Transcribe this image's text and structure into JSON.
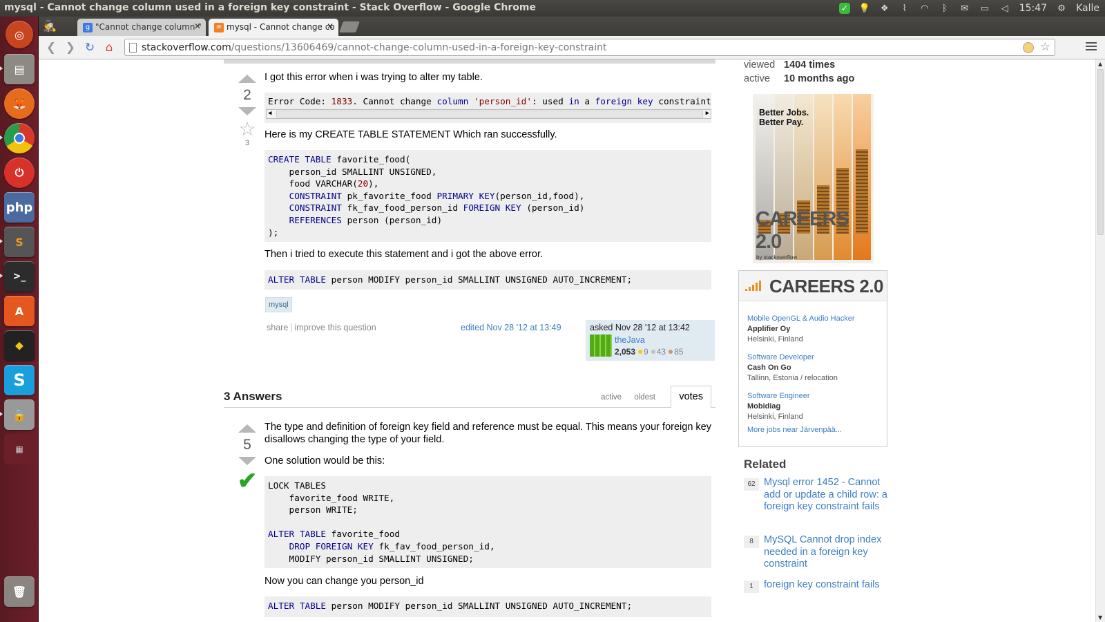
{
  "window": {
    "title": "mysql - Cannot change column used in a foreign key constraint - Stack Overflow - Google Chrome"
  },
  "tray": {
    "time": "15:47",
    "user": "Kalle"
  },
  "tabs": [
    {
      "label": "\"Cannot change column \"",
      "favicon": "google-icon"
    },
    {
      "label": "mysql - Cannot change co",
      "favicon": "stackoverflow-icon"
    }
  ],
  "address": {
    "host": "stackoverflow.com",
    "path": "/questions/13606469/cannot-change-column-used-in-a-foreign-key-constraint"
  },
  "question": {
    "votes": "2",
    "favorites": "3",
    "intro": "I got this error when i was trying to alter my table.",
    "create_intro": "Here is my CREATE TABLE STATEMENT Which ran successfully.",
    "then_text": "Then i tried to execute this statement and i got the above error.",
    "tag": "mysql",
    "share": "share",
    "improve": "improve this question",
    "edited": "edited Nov 28 '12 at 13:49",
    "asked": "asked Nov 28 '12 at 13:42",
    "user": "theJava",
    "rep": "2,053",
    "gold": "9",
    "silver": "43",
    "bronze": "85"
  },
  "answers": {
    "count_label": "3 Answers",
    "tabs": [
      "active",
      "oldest",
      "votes"
    ],
    "top": {
      "votes": "5",
      "text1": "The type and definition of foreign key field and reference must be equal. This means your foreign key",
      "text2": "disallows changing the type of your field.",
      "solution": "One solution would be this:",
      "now": "Now you can change you person_id"
    }
  },
  "sidebar": {
    "viewed_label": "viewed",
    "viewed_value": "1404 times",
    "active_label": "active",
    "active_value": "10 months ago",
    "ad_tagline1": "Better Jobs.",
    "ad_tagline2": "Better Pay.",
    "ad_brand": "CAREERS 2.0",
    "ad_by": "by stackoverflow",
    "careers_title": "CAREERS 2.0",
    "jobs": [
      {
        "title": "Mobile OpenGL & Audio Hacker",
        "company": "Applifier Oy",
        "location": "Helsinki, Finland"
      },
      {
        "title": "Software Developer",
        "company": "Cash On Go",
        "location": "Tallinn, Estonia / relocation"
      },
      {
        "title": "Software Engineer",
        "company": "Mobidiag",
        "location": "Helsinki, Finland"
      }
    ],
    "more_jobs": "More jobs near Järvenpää...",
    "related_title": "Related",
    "related": [
      {
        "count": "62",
        "title": "Mysql error 1452 - Cannot add or update a child row: a foreign key constraint fails"
      },
      {
        "count": "8",
        "title": "MySQL Cannot drop index needed in a foreign key constraint"
      },
      {
        "count": "1",
        "title": "foreign key constraint fails"
      }
    ]
  }
}
